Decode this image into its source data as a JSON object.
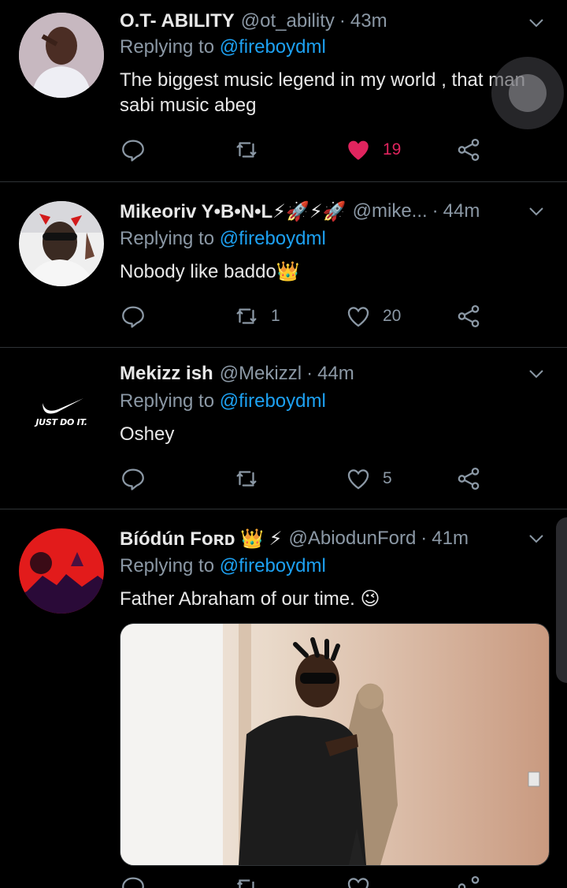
{
  "tweets": [
    {
      "name": "O.T- ABILITY",
      "handle": "@ot_ability",
      "time": "43m",
      "reply_prefix": "Replying to",
      "reply_to": "@fireboydml",
      "text_line1": "The biggest music legend in my world , that man",
      "text_line2": "sabi music abeg",
      "retweets": "",
      "likes": "19",
      "liked": true
    },
    {
      "name": "Mikeoriv Y•B•N•L⚡🚀⚡🚀",
      "handle": "@mike...",
      "time": "44m",
      "reply_prefix": "Replying to",
      "reply_to": "@fireboydml",
      "text": "Nobody like baddo👑",
      "retweets": "1",
      "likes": "20",
      "liked": false
    },
    {
      "name": "Mekizz ish",
      "handle": "@Mekizzl",
      "time": "44m",
      "reply_prefix": "Replying to",
      "reply_to": "@fireboydml",
      "text": "Oshey",
      "avatar_text": "JUST DO IT.",
      "retweets": "",
      "likes": "5",
      "liked": false
    },
    {
      "name": "Bíódún Fᴏʀᴅ 👑 ⚡",
      "handle": "@AbiodunFord",
      "time": "41m",
      "reply_prefix": "Replying to",
      "reply_to": "@fireboydml",
      "text": "Father Abraham of our time. 😉"
    }
  ],
  "colors": {
    "background": "#000000",
    "link": "#1da1f2",
    "muted": "#8b98a5",
    "like": "#e0245e",
    "divider": "#2f3336"
  },
  "icons": [
    "reply-icon",
    "retweet-icon",
    "like-icon",
    "share-icon",
    "chevron-down-icon"
  ]
}
